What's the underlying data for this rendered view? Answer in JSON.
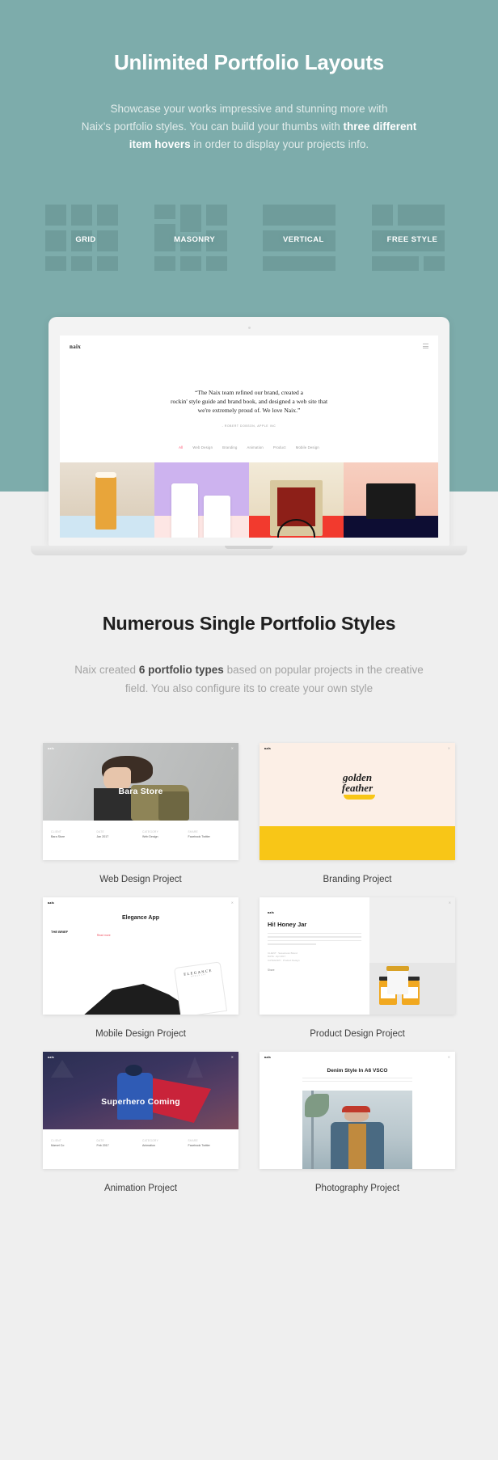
{
  "hero": {
    "title": "Unlimited Portfolio Layouts",
    "subtitle_line1": "Showcase your works impressive and stunning more with",
    "subtitle_line2_pre": "Naix's portfolio styles. You can build your thumbs with ",
    "subtitle_line2_bold": "three different",
    "subtitle_line3_bold": "item hovers",
    "subtitle_line3_post": " in order to display your projects info.",
    "bg_color": "#7dacab",
    "layouts": [
      {
        "label": "GRID"
      },
      {
        "label": "MASONRY"
      },
      {
        "label": "VERTICAL"
      },
      {
        "label": "FREE STYLE"
      }
    ]
  },
  "laptop": {
    "site_logo": "naix",
    "menu_icon": "hamburger-icon",
    "quote_line1": "“The Naix team refined our brand, created a",
    "quote_line2": "rockin' style guide and brand book, and designed a web site that",
    "quote_line3": "we're extremely proud of. We love Naix.”",
    "quote_author": "- ROBERT DOBSON, APPLE INC",
    "filters": [
      {
        "label": "All",
        "active": true
      },
      {
        "label": "Web Design",
        "active": false
      },
      {
        "label": "Branding",
        "active": false
      },
      {
        "label": "Animation",
        "active": false
      },
      {
        "label": "Product",
        "active": false
      },
      {
        "label": "Mobile Design",
        "active": false
      }
    ]
  },
  "lower": {
    "title": "Numerous Single Portfolio Styles",
    "sub_pre": "Naix created ",
    "sub_bold": "6 portfolio types",
    "sub_post": " based on popular projects in the creative",
    "sub_line2": "field. You also configure its to create your own style"
  },
  "portfolio": {
    "cards": [
      {
        "caption": "Web Design Project",
        "logo": "naix",
        "overlay_title": "Bara Store",
        "meta": [
          {
            "key": "CLIENT",
            "value": "Bara Store"
          },
          {
            "key": "DATE",
            "value": "Jan 2017"
          },
          {
            "key": "CATEGORY",
            "value": "Web Design"
          },
          {
            "key": "SHARE",
            "value": "Facebook Twitter"
          }
        ]
      },
      {
        "caption": "Branding Project",
        "logo": "naix",
        "brand_line1": "golden",
        "brand_line2": "feather",
        "accent_color": "#f8c617"
      },
      {
        "caption": "Mobile Design Project",
        "logo": "naix",
        "heading": "Elegance App",
        "side_label": "THE BRIEF",
        "device_word": "ELEGANCE",
        "device_sub": "MOBILE APP",
        "link": "Read more"
      },
      {
        "caption": "Product Design Project",
        "logo": "naix",
        "heading": "Hi! Honey Jar",
        "meta_lines": [
          "CLIENT : Sweetness Brand",
          "DATE : Apr 2017",
          "CATEGORY : Product Design"
        ],
        "share_label": "Share"
      },
      {
        "caption": "Animation Project",
        "logo": "naix",
        "overlay_title": "Superhero Coming",
        "meta": [
          {
            "key": "CLIENT",
            "value": "Marvel Co"
          },
          {
            "key": "DATE",
            "value": "Feb 2017"
          },
          {
            "key": "CATEGORY",
            "value": "Animation"
          },
          {
            "key": "SHARE",
            "value": "Facebook Twitter"
          }
        ]
      },
      {
        "caption": "Photography Project",
        "logo": "naix",
        "heading": "Denim Style In A6 VSCO"
      }
    ]
  }
}
